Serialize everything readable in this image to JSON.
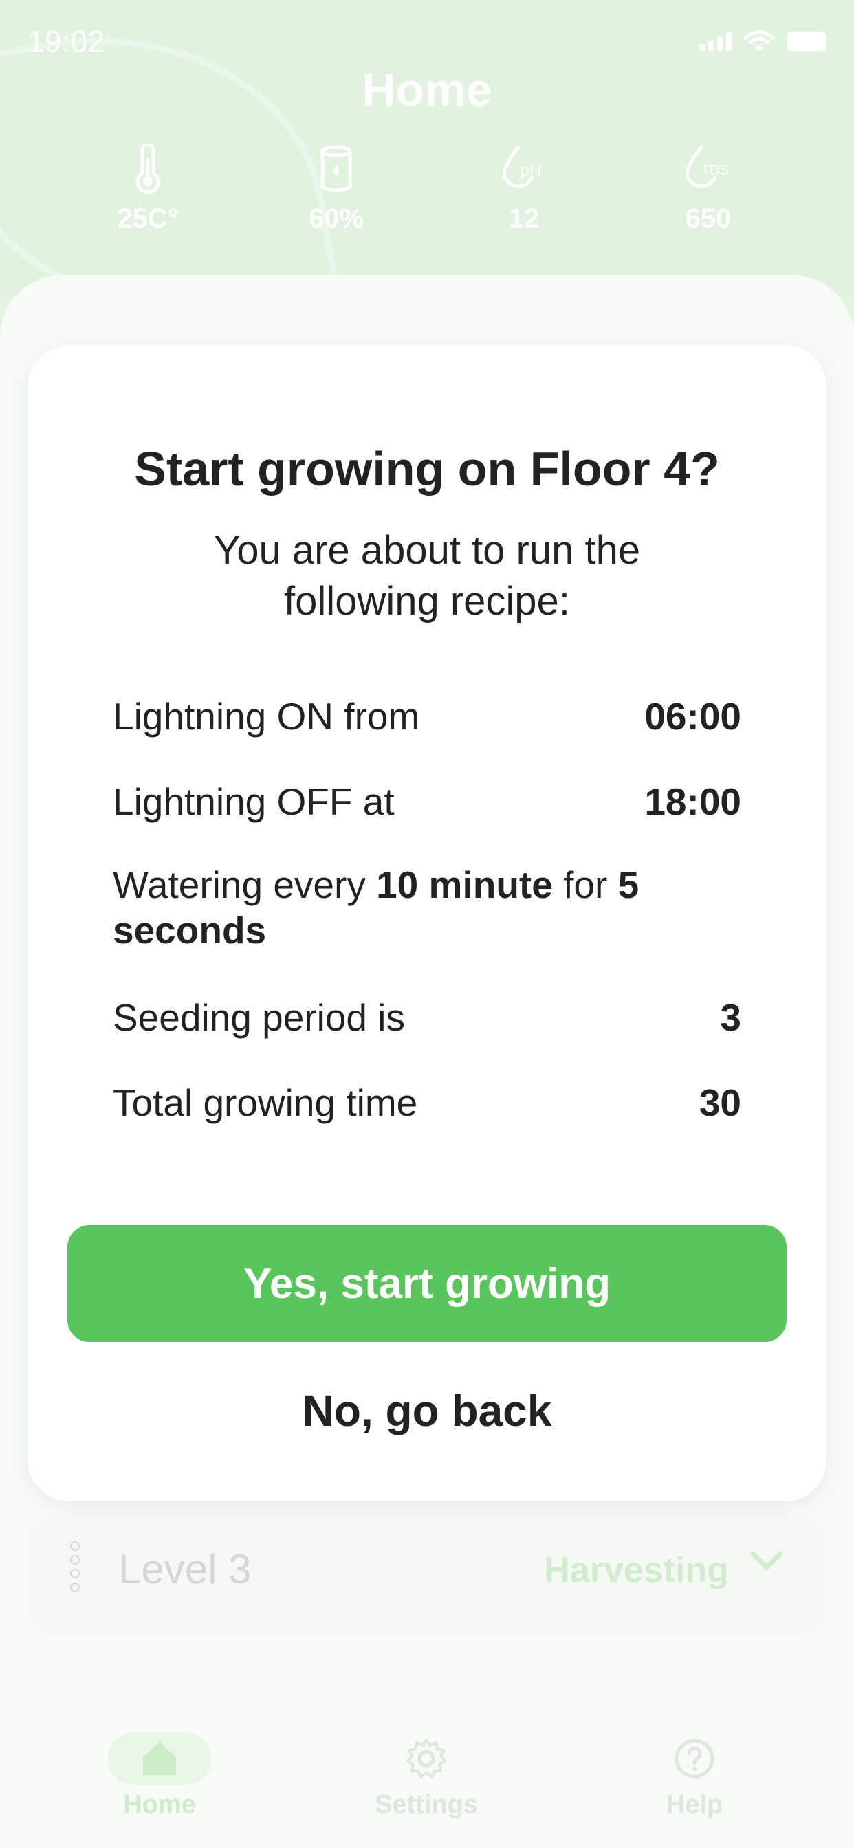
{
  "status_bar": {
    "time": "19:02"
  },
  "header": {
    "title": "Home",
    "stats": [
      {
        "icon": "thermometer-icon",
        "value": "25C°"
      },
      {
        "icon": "water-tank-icon",
        "value": "60%"
      },
      {
        "icon": "ph-drop-icon",
        "icon_text": "pH",
        "value": "12"
      },
      {
        "icon": "tds-drop-icon",
        "icon_text": "TDS",
        "value": "650"
      }
    ]
  },
  "modal": {
    "title": "Start growing on Floor 4?",
    "subtitle": "You are about to run the following recipe:",
    "lighting_on_label": "Lightning ON from",
    "lighting_on_value": "06:00",
    "lighting_off_label": "Lightning OFF at",
    "lighting_off_value": "18:00",
    "watering_prefix": "Watering every",
    "watering_interval": "10 minute",
    "watering_middle": "for",
    "watering_duration": "5 seconds",
    "seeding_label": "Seeding period is",
    "seeding_value": "3",
    "total_label": "Total growing time",
    "total_value": "30",
    "confirm_label": "Yes, start growing",
    "cancel_label": "No, go back"
  },
  "level_row": {
    "name": "Level 3",
    "status": "Harvesting"
  },
  "tabbar": {
    "items": [
      {
        "label": "Home",
        "icon": "home-icon",
        "active": true
      },
      {
        "label": "Settings",
        "icon": "gear-icon",
        "active": false
      },
      {
        "label": "Help",
        "icon": "help-icon",
        "active": false
      }
    ]
  },
  "colors": {
    "accent": "#5bc55d",
    "header_bg": "#e1f2df",
    "text": "#222222"
  }
}
